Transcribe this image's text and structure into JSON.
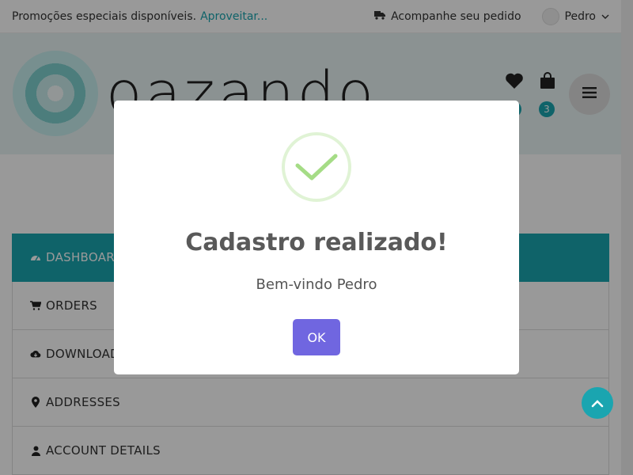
{
  "topbar": {
    "promo_text": "Promoções especiais disponíveis.",
    "promo_link": "Aproveitar...",
    "track_order": "Acompanhe seu pedido",
    "user_name": "Pedro"
  },
  "header": {
    "logo_text": "oazando",
    "wishlist_count": "",
    "cart_count": "3"
  },
  "account_nav": {
    "items": [
      {
        "label": "DASHBOARD",
        "icon": "dashboard-icon"
      },
      {
        "label": "ORDERS",
        "icon": "cart-icon"
      },
      {
        "label": "DOWNLOADS",
        "icon": "cloud-download-icon"
      },
      {
        "label": "ADDRESSES",
        "icon": "map-marker-icon"
      },
      {
        "label": "ACCOUNT DETAILS",
        "icon": "user-icon"
      }
    ]
  },
  "modal": {
    "title": "Cadastro realizado!",
    "text": "Bem-vindo Pedro",
    "ok_label": "OK"
  },
  "colors": {
    "accent": "#1aa5b0",
    "confirm_button": "#7066e0",
    "success": "#a5dc86"
  }
}
